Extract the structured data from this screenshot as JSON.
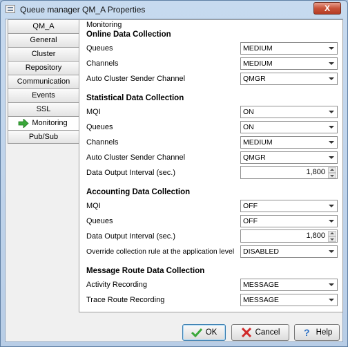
{
  "window": {
    "title": "Queue manager QM_A Properties",
    "close_label": "X"
  },
  "tabs": [
    {
      "label": "QM_A"
    },
    {
      "label": "General"
    },
    {
      "label": "Cluster"
    },
    {
      "label": "Repository"
    },
    {
      "label": "Communication"
    },
    {
      "label": "Events"
    },
    {
      "label": "SSL"
    },
    {
      "label": "Monitoring",
      "active": true
    },
    {
      "label": "Pub/Sub"
    }
  ],
  "panel": {
    "group_label": "Monitoring",
    "online": {
      "title": "Online Data Collection",
      "queues": {
        "label": "Queues",
        "value": "MEDIUM"
      },
      "channels": {
        "label": "Channels",
        "value": "MEDIUM"
      },
      "acs_channel": {
        "label": "Auto Cluster Sender Channel",
        "value": "QMGR"
      }
    },
    "statistical": {
      "title": "Statistical Data Collection",
      "mqi": {
        "label": "MQI",
        "value": "ON"
      },
      "queues": {
        "label": "Queues",
        "value": "ON"
      },
      "channels": {
        "label": "Channels",
        "value": "MEDIUM"
      },
      "acs_channel": {
        "label": "Auto Cluster Sender Channel",
        "value": "QMGR"
      },
      "interval": {
        "label": "Data Output Interval (sec.)",
        "value": "1,800"
      }
    },
    "accounting": {
      "title": "Accounting Data Collection",
      "mqi": {
        "label": "MQI",
        "value": "OFF"
      },
      "queues": {
        "label": "Queues",
        "value": "OFF"
      },
      "interval": {
        "label": "Data Output Interval (sec.)",
        "value": "1,800"
      },
      "override": {
        "label": "Override collection rule at the application level",
        "value": "DISABLED"
      }
    },
    "route": {
      "title": "Message Route Data Collection",
      "activity": {
        "label": "Activity Recording",
        "value": "MESSAGE"
      },
      "trace": {
        "label": "Trace Route Recording",
        "value": "MESSAGE"
      }
    }
  },
  "buttons": {
    "ok": "OK",
    "cancel": "Cancel",
    "help": "Help"
  },
  "colors": {
    "titlebar": "#c7daef",
    "accent_green": "#3aa83a",
    "cancel_red": "#d02a2a",
    "help_blue": "#2b6fc4"
  }
}
